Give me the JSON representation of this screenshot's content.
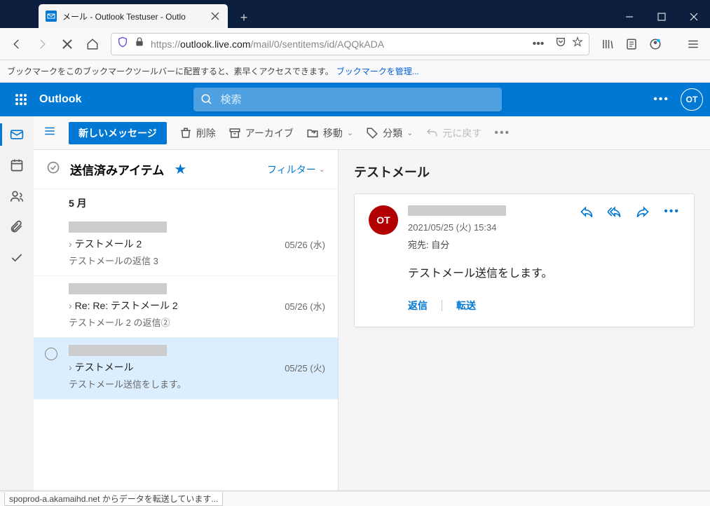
{
  "browser": {
    "tab_title": "メール - Outlook Testuser - Outlo",
    "url_prefix": "https://",
    "url_host": "outlook.live.com",
    "url_path": "/mail/0/sentitems/id/AQQkADA",
    "bookmark_hint": "ブックマークをこのブックマークツールバーに配置すると、素早くアクセスできます。",
    "bookmark_link": "ブックマークを管理...",
    "status": "spoprod-a.akamaihd.net からデータを転送しています..."
  },
  "suite": {
    "brand": "Outlook",
    "search_placeholder": "検索",
    "avatar": "OT"
  },
  "commands": {
    "new_message": "新しいメッセージ",
    "delete": "削除",
    "archive": "アーカイブ",
    "move": "移動",
    "categorize": "分類",
    "undo": "元に戻す"
  },
  "folder": {
    "title": "送信済みアイテム",
    "filter": "フィルター",
    "month_header": "5 月"
  },
  "messages": [
    {
      "subject": "テストメール 2",
      "preview": "テストメールの返信 3",
      "date": "05/26 (水)",
      "selected": false,
      "show_circle": false
    },
    {
      "subject": "Re: Re: テストメール 2",
      "preview": "テストメール 2 の返信②",
      "date": "05/26 (水)",
      "selected": false,
      "show_circle": false
    },
    {
      "subject": "テストメール",
      "preview": "テストメール送信をします。",
      "date": "05/25 (火)",
      "selected": true,
      "show_circle": true
    }
  ],
  "reading": {
    "title": "テストメール",
    "avatar": "OT",
    "date": "2021/05/25 (火) 15:34",
    "to_label": "宛先:",
    "to_value": "自分",
    "body": "テストメール送信をします。",
    "reply": "返信",
    "forward": "転送"
  }
}
